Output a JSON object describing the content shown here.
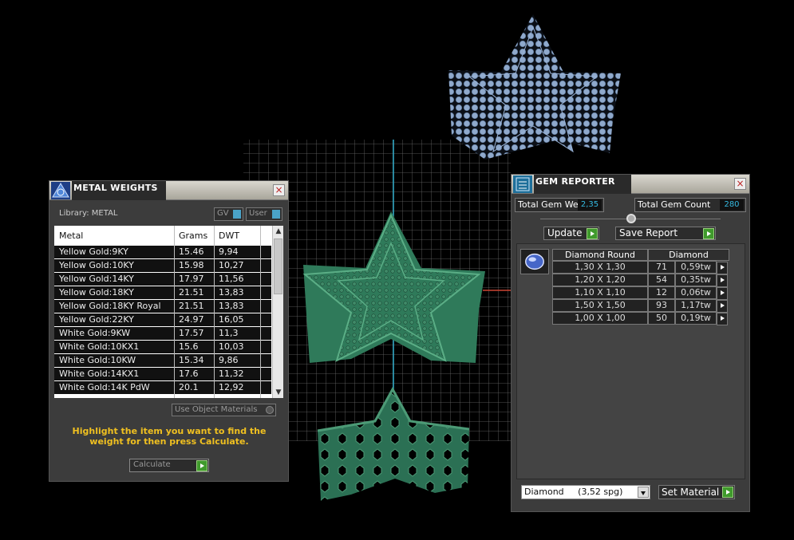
{
  "colors": {
    "accent_value": "#35b9e0",
    "hint": "#f0c020",
    "go_button": "#3f9a2c",
    "model_green": "#2f7a5a",
    "model_blue": "#8fa9cc"
  },
  "metal_panel": {
    "title": "METAL WEIGHTS",
    "close_label": "×",
    "library_label": "Library: METAL",
    "toggle_gv": "GV",
    "toggle_user": "User",
    "columns": [
      "Metal",
      "Grams",
      "DWT"
    ],
    "rows": [
      {
        "metal": "Yellow Gold:9KY",
        "grams": "15.46",
        "dwt": "9,94"
      },
      {
        "metal": "Yellow Gold:10KY",
        "grams": "15.98",
        "dwt": "10,27"
      },
      {
        "metal": "Yellow Gold:14KY",
        "grams": "17.97",
        "dwt": "11,56"
      },
      {
        "metal": "Yellow Gold:18KY",
        "grams": "21.51",
        "dwt": "13,83"
      },
      {
        "metal": "Yellow Gold:18KY Royal",
        "grams": "21.51",
        "dwt": "13,83"
      },
      {
        "metal": "Yellow Gold:22KY",
        "grams": "24.97",
        "dwt": "16,05"
      },
      {
        "metal": "White Gold:9KW",
        "grams": "17.57",
        "dwt": "11,3"
      },
      {
        "metal": "White Gold:10KX1",
        "grams": "15.6",
        "dwt": "10,03"
      },
      {
        "metal": "White Gold:10KW",
        "grams": "15.34",
        "dwt": "9,86"
      },
      {
        "metal": "White Gold:14KX1",
        "grams": "17.6",
        "dwt": "11,32"
      },
      {
        "metal": "White Gold:14K PdW",
        "grams": "20.1",
        "dwt": "12,92"
      }
    ],
    "use_object_materials": "Use Object Materials",
    "hint": "Highlight the item you want to find the weight for then press Calculate.",
    "calculate_label": "Calculate"
  },
  "gem_panel": {
    "title": "GEM REPORTER",
    "close_label": "×",
    "total_weight_label": "Total Gem Weight",
    "total_weight_value": "2,35",
    "total_count_label": "Total Gem Count",
    "total_count_value": "280",
    "update_label": "Update",
    "save_report_label": "Save Report",
    "table_header_shape": "Diamond Round",
    "table_header_material": "Diamond",
    "rows": [
      {
        "size": "1,30 X 1,30",
        "count": "71",
        "weight": "0,59tw"
      },
      {
        "size": "1,20 X 1,20",
        "count": "54",
        "weight": "0,35tw"
      },
      {
        "size": "1,10 X 1,10",
        "count": "12",
        "weight": "0,06tw"
      },
      {
        "size": "1,50 X 1,50",
        "count": "93",
        "weight": "1,17tw"
      },
      {
        "size": "1,00 X 1,00",
        "count": "50",
        "weight": "0,19tw"
      }
    ],
    "material_select": "Diamond     (3,52 spg)",
    "set_material_label": "Set Material"
  }
}
